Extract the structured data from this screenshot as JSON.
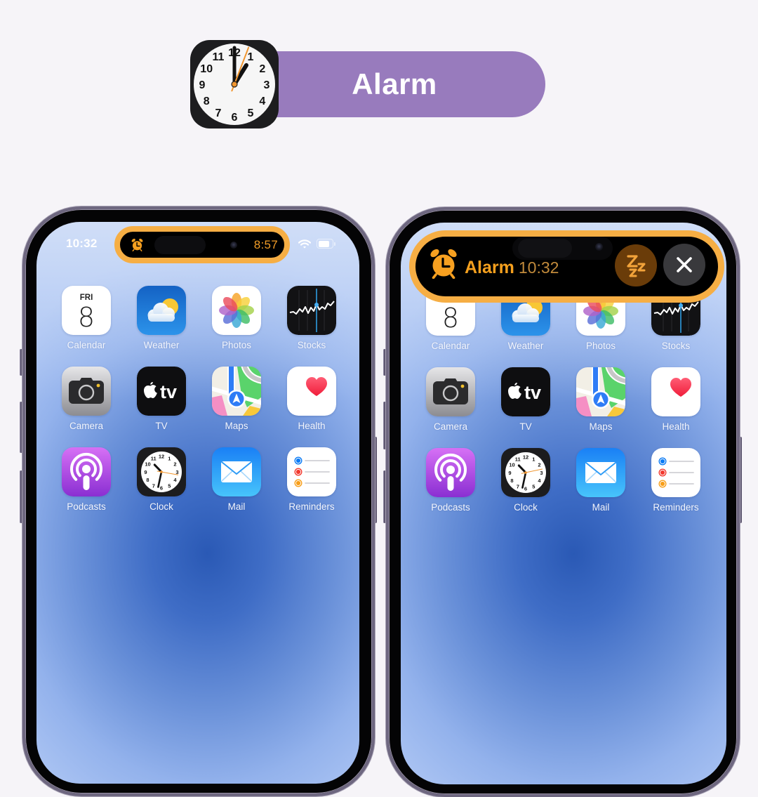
{
  "header": {
    "title": "Alarm",
    "icon": "clock-app-icon"
  },
  "theme": {
    "background": "#f6f4f8",
    "accent_purple": "#987bbd",
    "island_highlight": "#f6ae44",
    "alarm_orange": "#f5a01e"
  },
  "home_screen": {
    "apps": [
      {
        "label": "Calendar",
        "icon": "calendar-icon",
        "day": "FRI",
        "date": "8"
      },
      {
        "label": "Weather",
        "icon": "weather-icon"
      },
      {
        "label": "Photos",
        "icon": "photos-icon"
      },
      {
        "label": "Stocks",
        "icon": "stocks-icon"
      },
      {
        "label": "Camera",
        "icon": "camera-icon"
      },
      {
        "label": "TV",
        "icon": "tv-icon",
        "glyph_text": "tv"
      },
      {
        "label": "Maps",
        "icon": "maps-icon"
      },
      {
        "label": "Health",
        "icon": "health-icon"
      },
      {
        "label": "Podcasts",
        "icon": "podcasts-icon"
      },
      {
        "label": "Clock",
        "icon": "clock-icon"
      },
      {
        "label": "Mail",
        "icon": "mail-icon"
      },
      {
        "label": "Reminders",
        "icon": "reminders-icon"
      }
    ]
  },
  "phones": [
    {
      "variant": "compact",
      "status_bar": {
        "time": "10:32",
        "wifi_icon": "wifi-icon",
        "battery_icon": "battery-icon",
        "battery_level_percent": 80
      },
      "dynamic_island": {
        "state": "compact",
        "icon": "alarm-clock-icon",
        "trailing_text": "8:57"
      }
    },
    {
      "variant": "expanded",
      "dynamic_island": {
        "state": "expanded",
        "icon": "alarm-clock-icon",
        "title": "Alarm",
        "time": "10:32",
        "snooze_button_icon": "snooze-icon",
        "dismiss_button_icon": "close-icon"
      }
    }
  ]
}
